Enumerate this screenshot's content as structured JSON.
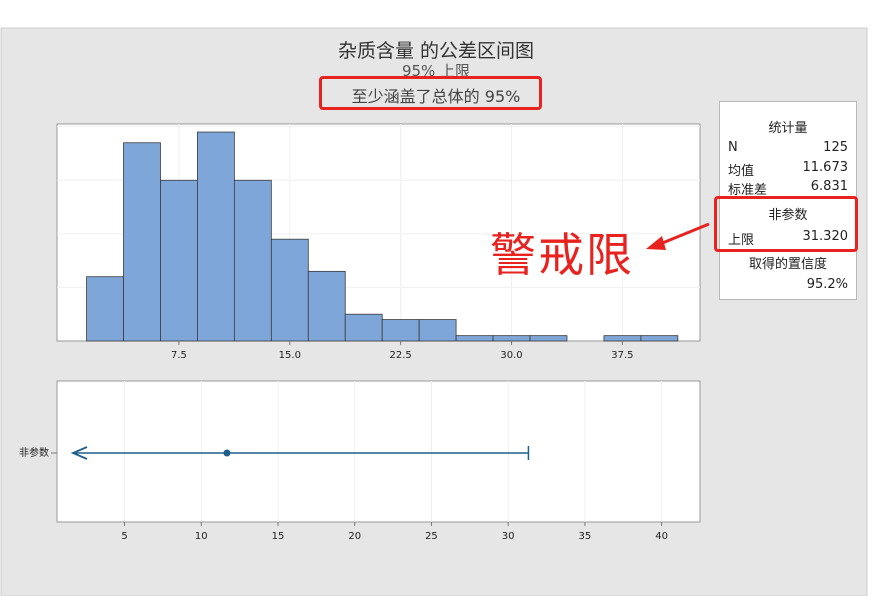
{
  "header": {
    "title": "杂质含量 的公差区间图",
    "subtitle1": "95% 上限",
    "subtitle2": "至少涵盖了总体的 95%"
  },
  "annotation": {
    "text": "警戒限"
  },
  "stats": {
    "heading": "统计量",
    "rows": [
      {
        "label": "N",
        "value": "125"
      },
      {
        "label": "均值",
        "value": "11.673"
      },
      {
        "label": "标准差",
        "value": "6.831"
      }
    ],
    "nonparam_heading": "非参数",
    "upper_label": "上限",
    "upper_value": "31.320",
    "confidence_label": "取得的置信度",
    "confidence_value": "95.2%"
  },
  "colors": {
    "bar_fill": "#7ea6d8",
    "interval_line": "#1f5f8b",
    "highlight": "#e8231f"
  },
  "chart_data": [
    {
      "type": "bar",
      "subtype": "histogram",
      "bin_edges": [
        1.25,
        3.75,
        6.25,
        8.75,
        11.25,
        13.75,
        16.25,
        18.75,
        21.25,
        23.75,
        26.25,
        28.75,
        31.25,
        33.75,
        36.25,
        38.75,
        41.25
      ],
      "values": [
        12,
        37,
        30,
        39,
        30,
        19,
        13,
        5,
        4,
        4,
        1,
        1,
        1,
        0,
        1,
        1
      ],
      "xlim": [
        -0.75,
        42.75
      ],
      "ylim": [
        0,
        40.5
      ],
      "xticks": [
        7.5,
        15.0,
        22.5,
        30.0,
        37.5
      ],
      "xtick_labels": [
        "7.5",
        "15.0",
        "22.5",
        "30.0",
        "37.5"
      ],
      "grid": true
    },
    {
      "type": "interval",
      "category_label": "非参数",
      "mean": 11.673,
      "upper": 31.32,
      "lower_unbounded": true,
      "xlim": [
        0.6,
        42.5
      ],
      "xticks": [
        5,
        10,
        15,
        20,
        25,
        30,
        35,
        40
      ],
      "xtick_labels": [
        "5",
        "10",
        "15",
        "20",
        "25",
        "30",
        "35",
        "40"
      ],
      "grid": true
    }
  ]
}
